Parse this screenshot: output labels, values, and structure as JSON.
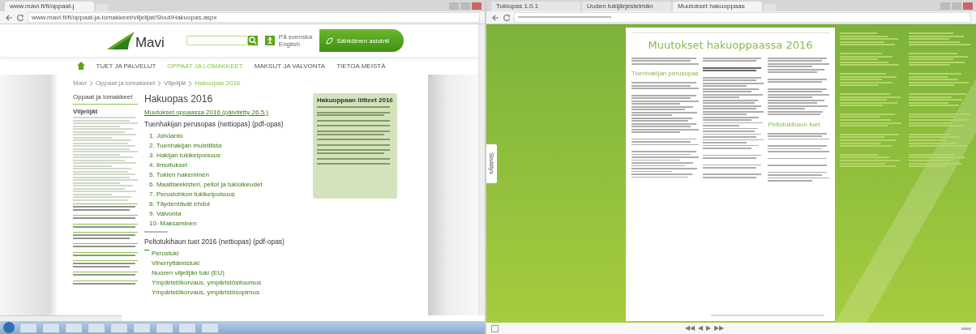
{
  "left_browser": {
    "tab_title": "www.mavi.fi/fi/oppaat-j",
    "url": "www.mavi.fi/fi/oppaat-ja-lomakkeet/viljelijat/Sivut/Hakuopas.aspx",
    "site": {
      "logo": "Mavi",
      "lang_links": [
        "På svenska",
        "English"
      ],
      "eservice_button": "Sähköinen asiointi",
      "nav": [
        {
          "label": "TUET JA PALVELUT",
          "selected": false
        },
        {
          "label": "OPPAAT JA LOMAKKEET",
          "selected": true
        },
        {
          "label": "MAKSUT JA VALVONTA",
          "selected": false
        },
        {
          "label": "TIETOA MEISTÄ",
          "selected": false
        }
      ],
      "breadcrumb": [
        {
          "label": "Mavi",
          "current": false
        },
        {
          "label": "Oppaat ja lomakkeet",
          "current": false
        },
        {
          "label": "Viljelijät",
          "current": false
        },
        {
          "label": "Hakuopas 2016",
          "current": true
        }
      ],
      "sidebar": {
        "title": "Oppaat ja lomakkeet",
        "section": "Viljelijät"
      },
      "main": {
        "title": "Hakuopas 2016",
        "changes_link": "Muutokset oppaassa 2016 (päivitetty 26.5.)",
        "sections": [
          {
            "heading": "Tuenhakijan perusopas (nettiopas) (pdf-opas)",
            "items": [
              "1. Johdanto",
              "2. Tuenhakijan muistilista",
              "3. Hakijan tukikelpoisuus",
              "4. Ilmoitukset",
              "5. Tukien hakeminen",
              "6. Maatilarekisteri, pellot ja tukioikeudet",
              "7. Peruslohkon tukikelpoisuus",
              "8. Täydentävät ehdot",
              "9. Valvonta",
              "10. Maksaminen"
            ]
          },
          {
            "heading": "Peltotukihaun tuet 2016 (nettiopas) (pdf-opas)",
            "items": [
              "Perustuki",
              "Viherryttämistuki",
              "Nuoren viljelijän tuki (EU)",
              "Ympäristökorvaus, ympäristösitoumus",
              "Ympäristökorvaus, ympäristösopimus"
            ]
          }
        ]
      },
      "attachments": {
        "title": "Hakuoppaan liitteet 2016"
      }
    }
  },
  "right_browser": {
    "tabs": [
      {
        "label": "Tukiopas 1.0.1",
        "selected": false
      },
      {
        "label": "Uuden tukijärjestelmän",
        "selected": false
      },
      {
        "label": "Muutokset hakuoppaas",
        "selected": true
      }
    ],
    "side_tab": "Sisällys",
    "document": {
      "title": "Muutokset hakuoppaassa 2016",
      "headings": [
        "Tuenhakijan perusopas",
        "Peltotukihaun tuet"
      ]
    },
    "pager": [
      "◀◀",
      "◀",
      "▶",
      "▶▶"
    ]
  }
}
